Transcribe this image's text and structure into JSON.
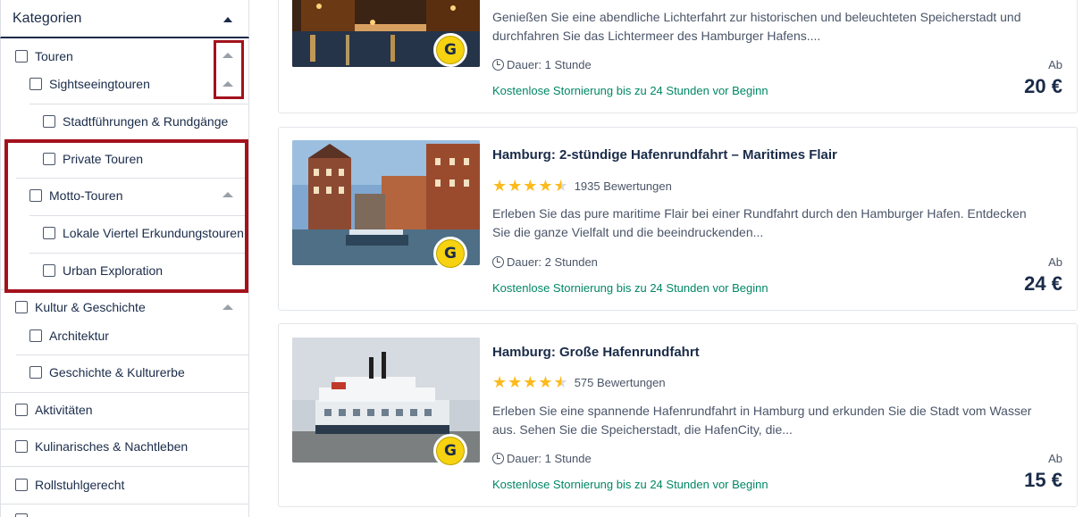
{
  "sidebar": {
    "header": "Kategorien",
    "items": [
      {
        "label": "Touren"
      },
      {
        "label": "Sightseeingtouren"
      },
      {
        "label": "Stadtführungen & Rundgänge"
      },
      {
        "label": "Private Touren"
      },
      {
        "label": "Motto-Touren"
      },
      {
        "label": "Lokale Viertel Erkundungstouren"
      },
      {
        "label": "Urban Exploration"
      },
      {
        "label": "Kultur & Geschichte"
      },
      {
        "label": "Architektur"
      },
      {
        "label": "Geschichte & Kulturerbe"
      },
      {
        "label": "Aktivitäten"
      },
      {
        "label": "Kulinarisches & Nachtleben"
      },
      {
        "label": "Rollstuhlgerecht"
      }
    ]
  },
  "cards": [
    {
      "title": "",
      "description": "Genießen Sie eine abendliche Lichterfahrt zur historischen und beleuchteten Speicherstadt und durchfahren Sie das Lichtermeer des Hamburger Hafens....",
      "duration": "Dauer: 1 Stunde",
      "cancellation": "Kostenlose Stornierung bis zu 24 Stunden vor Beginn",
      "price_prefix": "Ab",
      "price": "20 €",
      "badge": "G"
    },
    {
      "title": "Hamburg: 2-stündige Hafenrundfahrt – Maritimes Flair",
      "rating": 4.5,
      "reviews": "1935 Bewertungen",
      "description": "Erleben Sie das pure maritime Flair bei einer Rundfahrt durch den Hamburger Hafen. Entdecken Sie die ganze Vielfalt und die beeindruckenden...",
      "duration": "Dauer: 2 Stunden",
      "cancellation": "Kostenlose Stornierung bis zu 24 Stunden vor Beginn",
      "price_prefix": "Ab",
      "price": "24 €",
      "badge": "G"
    },
    {
      "title": "Hamburg: Große Hafenrundfahrt",
      "rating": 4.5,
      "reviews": "575 Bewertungen",
      "description": "Erleben Sie eine spannende Hafenrundfahrt in Hamburg und erkunden Sie die Stadt vom Wasser aus. Sehen Sie die Speicherstadt, die HafenCity, die...",
      "duration": "Dauer: 1 Stunde",
      "cancellation": "Kostenlose Stornierung bis zu 24 Stunden vor Beginn",
      "price_prefix": "Ab",
      "price": "15 €",
      "badge": "G"
    }
  ],
  "colors": {
    "accent_navy": "#1a2b49",
    "cancellation_green": "#008765",
    "star_yellow": "#fdba1b",
    "highlight_red": "#a4121c",
    "badge_yellow": "#f6d210"
  }
}
